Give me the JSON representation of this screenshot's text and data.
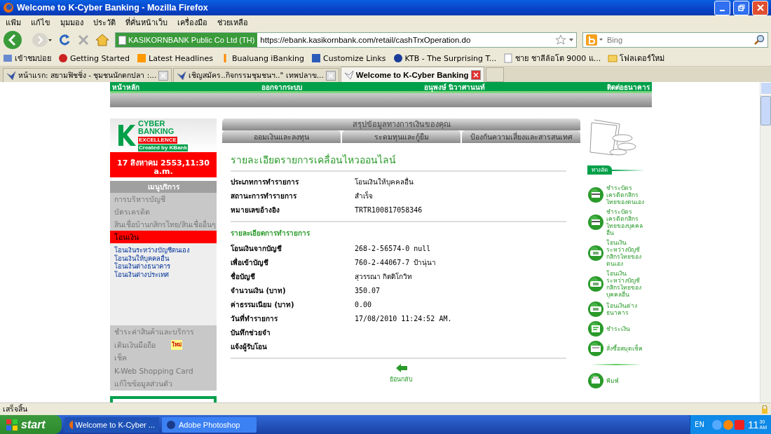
{
  "window": {
    "title": "Welcome to K-Cyber Banking - Mozilla Firefox"
  },
  "menu": [
    "แฟ้ม",
    "แก้ไข",
    "มุมมอง",
    "ประวัติ",
    "ที่คั่นหน้าเว็บ",
    "เครื่องมือ",
    "ช่วยเหลือ"
  ],
  "navbar": {
    "identity": "KASIKORNBANK Public Co Ltd (TH)",
    "url": "https://ebank.kasikornbank.com/retail/cashTrxOperation.do",
    "search_placeholder": "Bing"
  },
  "bookmarks": [
    "เข้าชมบ่อย",
    "Getting Started",
    "Latest Headlines",
    "Bualuang iBanking",
    "Customize Links",
    "KTB - The Surprising T...",
    "ชาย ชาลีล้อโต 9000 แ...",
    "โฟลเดอร์ใหม่"
  ],
  "tabs": [
    {
      "label": "หน้าแรก: สยามฟิชชิ่ง - ชุมชนนักตกปลา :...",
      "selected": false
    },
    {
      "label": "เชิญสมัคร..กิจกรรมชุมชนฯ..\" เทพปลาข...",
      "selected": false
    },
    {
      "label": "Welcome to K-Cyber Banking",
      "selected": true
    }
  ],
  "page": {
    "top_links": [
      "หน้าหลัก",
      "ออกจากระบบ",
      "อนุพงษ์ นิวาศานนท์",
      "ติดต่อธนาคาร"
    ],
    "sidebar": {
      "logo": {
        "line1": "CYBER",
        "line2": "BANKING",
        "badge": "EXCELLENCE",
        "credit": "Created by KBank"
      },
      "date": "17 สิงหาคม 2553,11:30 a.m.",
      "menu_title": "เมนูบริการ",
      "items": [
        {
          "label": "การบริหารบัญชี",
          "selected": false
        },
        {
          "label": "บัตรเครดิต",
          "selected": false
        },
        {
          "label": "สินเชื่อบ้านกสิกรไทย/สินเชื่ออื่นๆ",
          "selected": false
        },
        {
          "label": "โอนเงิน",
          "selected": true,
          "children": [
            "โอนเงินระหว่างบัญชีตนเอง",
            "โอนเงินให้บุคคลอื่น",
            "โอนเงินต่างธนาคาร",
            "โอนเงินต่างประเทศ"
          ]
        }
      ],
      "more_items": [
        {
          "label": "ชำระค่าสินค้าและบริการ"
        },
        {
          "label": "เติมเงินมือถือ",
          "badge": "ใหม่"
        },
        {
          "label": "เช็ค"
        },
        {
          "label": "K-Web Shopping Card"
        },
        {
          "label": "แก้ไขข้อมูลส่วนตัว"
        }
      ]
    },
    "summary": {
      "title": "สรุปข้อมูลทางการเงินของคุณ",
      "tabs": [
        "ออมเงินและลงทุน",
        "ระดมทุนและกู้ยืม",
        "ป้องกันความเสี่ยงและสารสนเทศ"
      ]
    },
    "detail": {
      "title": "รายละเอียดรายการเคลื่อนไหวออนไลน์",
      "rows": [
        {
          "label": "ประเภทการทำรายการ",
          "value": "โอนเงินให้บุคคลอื่น"
        },
        {
          "label": "สถานะการทำรายการ",
          "value": "สำเร็จ"
        },
        {
          "label": "หมายเลขอ้างอิง",
          "value": "TRTR100817058346"
        }
      ],
      "section": "รายละเอียดการทำรายการ",
      "rows2": [
        {
          "label": "โอนเงินจากบัญชี",
          "value": "268-2-56574-0 null"
        },
        {
          "label": "เพื่อเข้าบัญชี",
          "value": "760-2-44067-7 ป้านุ่นา"
        },
        {
          "label": "ชื่อบัญชี",
          "value": "สุวรรณา กิตติโกวิท"
        },
        {
          "label": "จำนวนเงิน (บาท)",
          "value": "350.07"
        },
        {
          "label": "ค่าธรรมเนียม (บาท)",
          "value": "0.00"
        },
        {
          "label": "วันที่ทำรายการ",
          "value": "17/08/2010 11:24:52 AM."
        },
        {
          "label": "บันทึกช่วยจำ"
        },
        {
          "label": "แจ้งผู้รับโอน"
        }
      ],
      "back": "ย้อนกลับ"
    },
    "shortcuts": {
      "title": "ทางลัด",
      "items": [
        {
          "label": "ชำระบัตรเครดิตกสิกรไทยของตนเอง",
          "kind": "card"
        },
        {
          "label": "ชำระบัตรเครดิตกสิกรไทยของบุคคลอื่น",
          "kind": "card"
        },
        {
          "label": "โอนเงินระหว่างบัญชีกสิกรไทยของตนเอง",
          "kind": "transfer"
        },
        {
          "label": "โอนเงินระหว่างบัญชีกสิกรไทยของบุคคลอื่น",
          "kind": "transfer"
        },
        {
          "label": "โอนเงินต่างธนาคาร",
          "kind": "transfer"
        },
        {
          "label": "ชำระเงิน",
          "kind": "bill"
        },
        {
          "label": "สั่งซื้อสมุดเช็ค",
          "kind": "book"
        }
      ],
      "print": "พิมพ์"
    }
  },
  "status_bar": "เสร็จสิ้น",
  "taskbar": {
    "start": "start",
    "tasks": [
      {
        "label": "Welcome to K-Cyber ...",
        "selected": true
      },
      {
        "label": "Adobe Photoshop",
        "selected": false
      }
    ],
    "language": "EN",
    "clock": {
      "hour": "11",
      "minute": "30",
      "ampm": "AM"
    }
  }
}
